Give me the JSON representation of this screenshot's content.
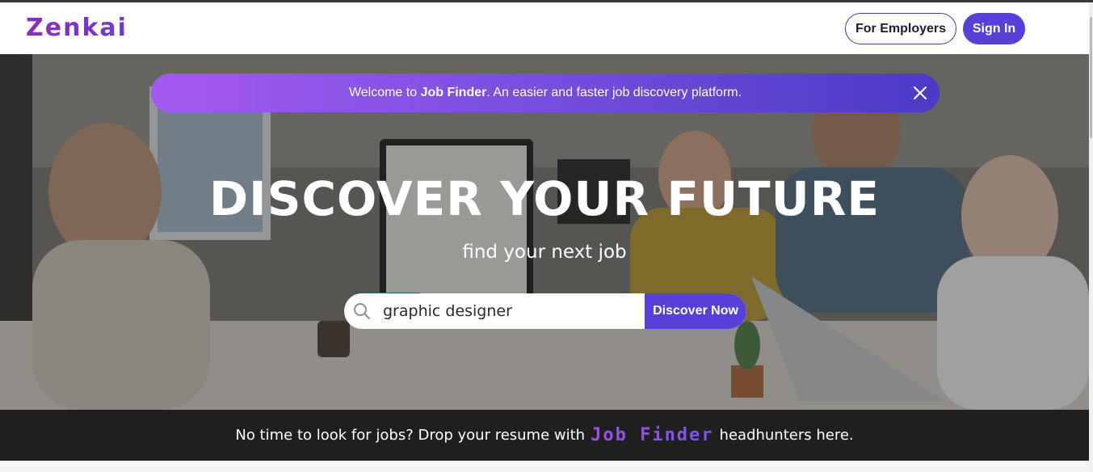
{
  "navbar": {
    "logo": "Zenkai",
    "employers_label": "For Employers",
    "signin_label": "Sign In"
  },
  "banner": {
    "prefix": "Welcome to ",
    "brand": "Job Finder",
    "suffix": ". An easier and faster job discovery platform.",
    "close_icon": "close-icon"
  },
  "hero": {
    "title": "DISCOVER YOUR FUTURE",
    "subtitle": "find your next job"
  },
  "search": {
    "value": "graphic designer",
    "button_label": "Discover Now",
    "icon": "search-icon"
  },
  "footer": {
    "prefix": "No time to look for jobs? Drop your resume with",
    "brand": "Job Finder",
    "suffix": "headhunters here."
  },
  "colors": {
    "accent": "#5640d9",
    "brand_purple": "#8e2db8",
    "banner_start": "#a659f2",
    "banner_end": "#4a3ac6",
    "footer_bg": "#1f1f1f"
  }
}
